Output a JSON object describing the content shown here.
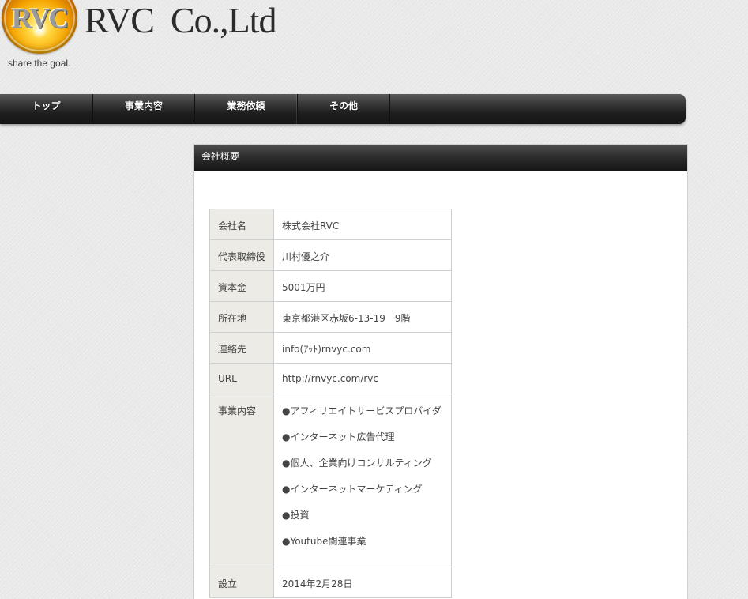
{
  "header": {
    "emblem_text": "RVC",
    "company_name": "RVC  Co.,Ltd",
    "tagline": "share the goal."
  },
  "nav": {
    "items": [
      "トップ",
      "事業内容",
      "業務依頼",
      "その他"
    ]
  },
  "panel": {
    "title": "会社概要"
  },
  "company": {
    "rows": [
      {
        "label": "会社名",
        "value": "株式会社RVC"
      },
      {
        "label": "代表取締役",
        "value": "川村優之介"
      },
      {
        "label": "資本金",
        "value": "5001万円"
      },
      {
        "label": "所在地",
        "value": "東京都港区赤坂6-13-19　9階"
      },
      {
        "label": "連絡先",
        "value": "info(ｱｯﾄ)rnvyc.com"
      },
      {
        "label": "URL",
        "value": "http://rnvyc.com/rvc"
      }
    ],
    "business": {
      "label": "事業内容",
      "items": [
        "●アフィリエイトサービスプロバイダ",
        "●インターネット広告代理",
        "●個人、企業向けコンサルティング",
        "●インターネットマーケティング",
        "●投資",
        "●Youtube関連事業"
      ]
    },
    "established": {
      "label": "設立",
      "value": "2014年2月28日"
    }
  }
}
